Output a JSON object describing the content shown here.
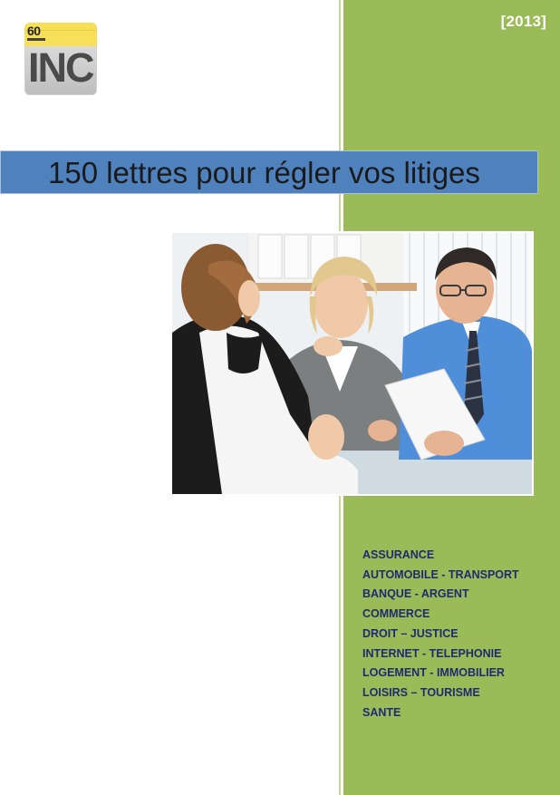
{
  "logo": {
    "number": "60",
    "letters": "INC"
  },
  "year": "[2013]",
  "title": "150 lettres pour régler vos litiges",
  "categories": [
    "ASSURANCE",
    "AUTOMOBILE - TRANSPORT",
    "BANQUE - ARGENT",
    "COMMERCE",
    "DROIT – JUSTICE",
    "INTERNET - TELEPHONIE",
    "LOGEMENT - IMMOBILIER",
    "LOISIRS – TOURISME",
    "SANTE"
  ],
  "colors": {
    "green_column": "#9bbb59",
    "title_banner": "#4f81bd",
    "category_text": "#1f2a70"
  }
}
